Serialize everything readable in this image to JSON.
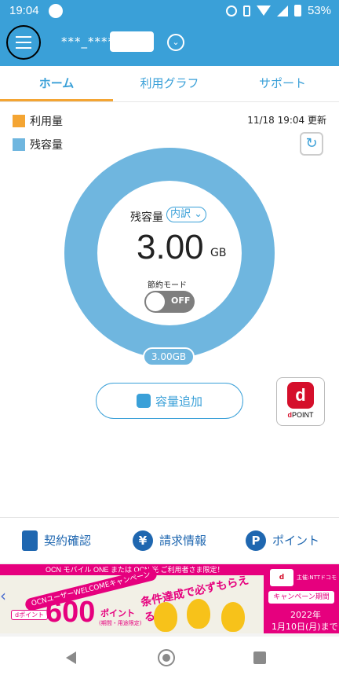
{
  "status_bar": {
    "time": "19:04",
    "battery_text": "53%"
  },
  "app_bar": {
    "account_masked": "***_****"
  },
  "tabs": [
    {
      "label": "ホーム",
      "active": true
    },
    {
      "label": "利用グラフ",
      "active": false
    },
    {
      "label": "サポート",
      "active": false
    }
  ],
  "usage": {
    "legend": [
      {
        "label": "利用量",
        "color": "#f4a533"
      },
      {
        "label": "残容量",
        "color": "#6fb6df"
      }
    ],
    "updated_text": "11/18 19:04 更新",
    "remaining_label": "残容量",
    "breakdown_label": "内訳",
    "remaining_value": "3.00",
    "remaining_unit": "GB",
    "saving_mode_label": "節約モード",
    "saving_mode_state": "OFF",
    "remaining_pill": "3.00GB"
  },
  "actions": {
    "add_capacity_label": "容量追加",
    "dpoint_label": "POINT"
  },
  "bottom_nav": [
    {
      "label": "契約確認",
      "icon": "clipboard-icon"
    },
    {
      "label": "請求情報",
      "icon": "yen-icon"
    },
    {
      "label": "ポイント",
      "icon": "point-icon"
    }
  ],
  "banner": {
    "top_text": "OCN モバイル ONE または OCN 光 ご利用者さま限定！",
    "welcome_text": "OCNユーザーWELCOMEキャンペーン",
    "dpoint_tag": "dポイント",
    "points": "600",
    "points_label": "ポイント",
    "points_note": "(期間・用途限定)",
    "condition_text": "条件達成で必ずもらえる!",
    "sponsor": "主催:NTTドコモ",
    "campaign_period_label": "キャンペーン期間",
    "end_year": "2022年",
    "end_date": "1月10日(月)まで"
  },
  "colors": {
    "primary": "#3aa0d8",
    "accent_orange": "#f4a533",
    "remaining_blue": "#6fb6df",
    "dpoint_red": "#d50f2b",
    "nav_blue": "#1f67b0",
    "banner_magenta": "#e6007e"
  }
}
